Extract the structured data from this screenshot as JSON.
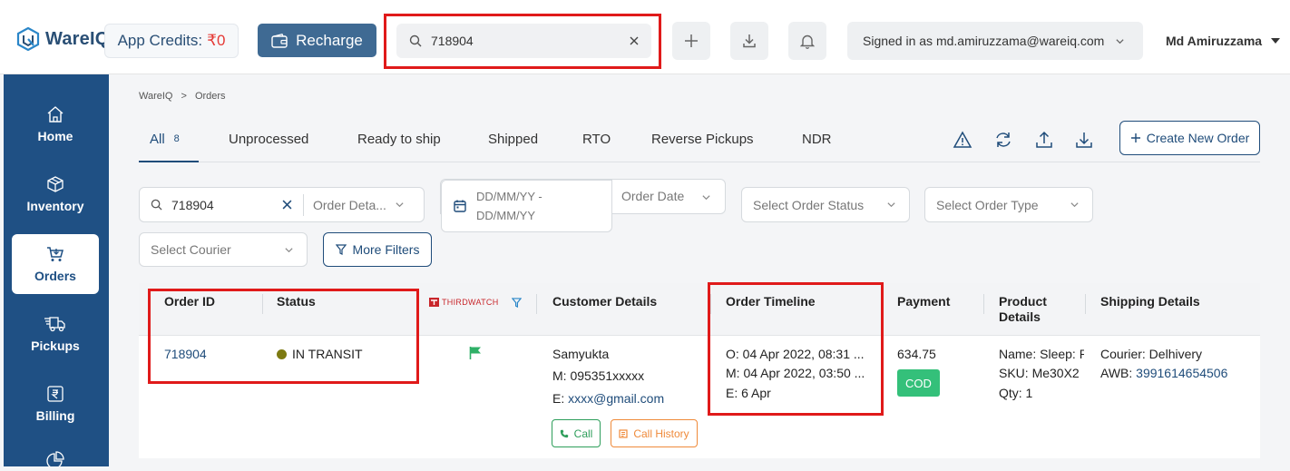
{
  "app": {
    "name": "WareIQ"
  },
  "header": {
    "credits_label": "App Credits:",
    "credits_value": "₹0",
    "recharge_label": "Recharge",
    "search_value": "718904",
    "signed_in": "Signed in as md.amiruzzama@wareiq.com",
    "user_name": "Md Amiruzzama"
  },
  "sidebar": {
    "items": [
      {
        "label": "Home",
        "icon": "home-icon"
      },
      {
        "label": "Inventory",
        "icon": "box-icon"
      },
      {
        "label": "Orders",
        "icon": "cart-icon"
      },
      {
        "label": "Pickups",
        "icon": "truck-icon"
      },
      {
        "label": "Billing",
        "icon": "rupee-icon"
      }
    ]
  },
  "breadcrumb": {
    "root": "WareIQ",
    "sep": ">",
    "current": "Orders"
  },
  "tabs": [
    {
      "label": "All",
      "count": "8"
    },
    {
      "label": "Unprocessed"
    },
    {
      "label": "Ready to ship"
    },
    {
      "label": "Shipped"
    },
    {
      "label": "RTO"
    },
    {
      "label": "Reverse Pickups"
    },
    {
      "label": "NDR"
    }
  ],
  "actions": {
    "create_label": "Create New Order"
  },
  "filters": {
    "search_value": "718904",
    "order_details_placeholder": "Order Deta...",
    "date_placeholder_line1": "DD/MM/YY -",
    "date_placeholder_line2": "DD/MM/YY",
    "order_date_label": "Order Date",
    "order_status_placeholder": "Select Order Status",
    "order_type_placeholder": "Select Order Type",
    "courier_placeholder": "Select Courier",
    "more_filters_label": "More Filters"
  },
  "table": {
    "headers": {
      "order_id": "Order ID",
      "status": "Status",
      "thirdwatch": "THIRDWATCH",
      "customer": "Customer Details",
      "timeline": "Order Timeline",
      "payment": "Payment",
      "product_line1": "Product",
      "product_line2": "Details",
      "shipping": "Shipping Details"
    },
    "row": {
      "order_id": "718904",
      "status": "IN TRANSIT",
      "customer_name": "Samyukta",
      "customer_mobile": "M: 095351xxxxx",
      "customer_email_label": "E: ",
      "customer_email": "xxxx@gmail.com",
      "call_label": "Call",
      "call_history_label": "Call History",
      "timeline_o": "O: 04 Apr 2022, 08:31 ...",
      "timeline_m": "M: 04 Apr 2022, 03:50 ...",
      "timeline_e": "E: 6 Apr",
      "payment_amount": "634.75",
      "payment_mode": "COD",
      "product_name": "Name: Sleep: R",
      "product_sku": "SKU: Me30X2",
      "product_qty": "Qty: 1",
      "courier": "Courier: Delhivery",
      "awb_label": "AWB: ",
      "awb": "3991614654506"
    }
  },
  "colors": {
    "brand": "#1f5084",
    "accent": "#3f6a93",
    "highlight": "#e01a1a",
    "cod": "#34c07a",
    "call": "#2e9e5b",
    "call_history": "#ef8a3a",
    "status_dot": "#7d7a12"
  }
}
